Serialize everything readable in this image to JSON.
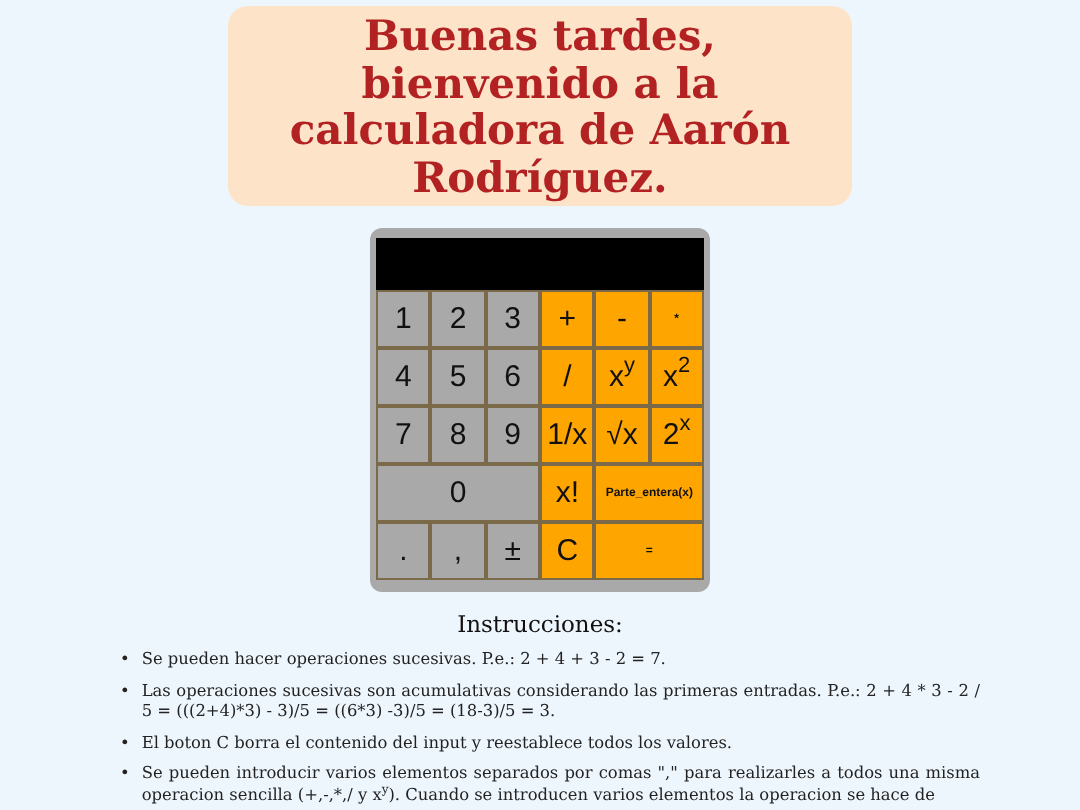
{
  "greeting": "Buenas tardes, bienvenido a la calculadora de Aarón Rodríguez.",
  "calculator": {
    "buttons": [
      {
        "label": "1",
        "kind": "digit",
        "wide": false
      },
      {
        "label": "2",
        "kind": "digit",
        "wide": false
      },
      {
        "label": "3",
        "kind": "digit",
        "wide": false
      },
      {
        "label": "+",
        "kind": "operator",
        "wide": false
      },
      {
        "label": "-",
        "kind": "operator",
        "wide": false
      },
      {
        "label": "*",
        "kind": "operator",
        "wide": false,
        "small": true
      },
      {
        "label": "4",
        "kind": "digit",
        "wide": false
      },
      {
        "label": "5",
        "kind": "digit",
        "wide": false
      },
      {
        "label": "6",
        "kind": "digit",
        "wide": false
      },
      {
        "label": "/",
        "kind": "operator",
        "wide": false
      },
      {
        "label": "x$^{y}$",
        "kind": "operator",
        "wide": false
      },
      {
        "label": "x$^{2}$",
        "kind": "operator",
        "wide": false
      },
      {
        "label": "7",
        "kind": "digit",
        "wide": false
      },
      {
        "label": "8",
        "kind": "digit",
        "wide": false
      },
      {
        "label": "9",
        "kind": "digit",
        "wide": false
      },
      {
        "label": "1/x",
        "kind": "operator",
        "wide": false
      },
      {
        "label": "√x",
        "kind": "operator",
        "wide": false
      },
      {
        "label": "2$^{x}$",
        "kind": "operator",
        "wide": false
      },
      {
        "label": "0",
        "kind": "digit",
        "wide": true
      },
      {
        "label": "x!",
        "kind": "operator",
        "wide": false
      },
      {
        "label": "Parte_entera(x)",
        "kind": "operator",
        "wide": true,
        "small": true
      },
      {
        "label": ".",
        "kind": "digit",
        "wide": false
      },
      {
        "label": ",",
        "kind": "digit",
        "wide": false
      },
      {
        "label": "±",
        "kind": "digit",
        "wide": false
      },
      {
        "label": "C",
        "kind": "operator",
        "wide": false
      },
      {
        "label": "=",
        "kind": "operator",
        "wide": true,
        "small": true
      }
    ]
  },
  "instructions": {
    "title": "Instrucciones:",
    "items": [
      {
        "marker": "•",
        "text": "Se pueden hacer operaciones sucesivas. P.e.: 2 + 4 + 3 - 2 = 7."
      },
      {
        "marker": "•",
        "text": "Las operaciones sucesivas son acumulativas considerando las primeras entradas. P.e.: 2 + 4 * 3 - 2 / 5 = (((2+4)*3) - 3)/5 = ((6*3) -3)/5 = (18-3)/5 = 3."
      },
      {
        "marker": "•",
        "text": "El boton C borra el contenido del input y reestablece todos los valores."
      },
      {
        "marker": "•",
        "text": "Se pueden introducir varios elementos separados por comas \",\" para realizarles a todos una misma operacion sencilla (+,-,*,/ y x$^{y}$). Cuando se introducen varios elementos la operacion se hace de"
      }
    ]
  }
}
